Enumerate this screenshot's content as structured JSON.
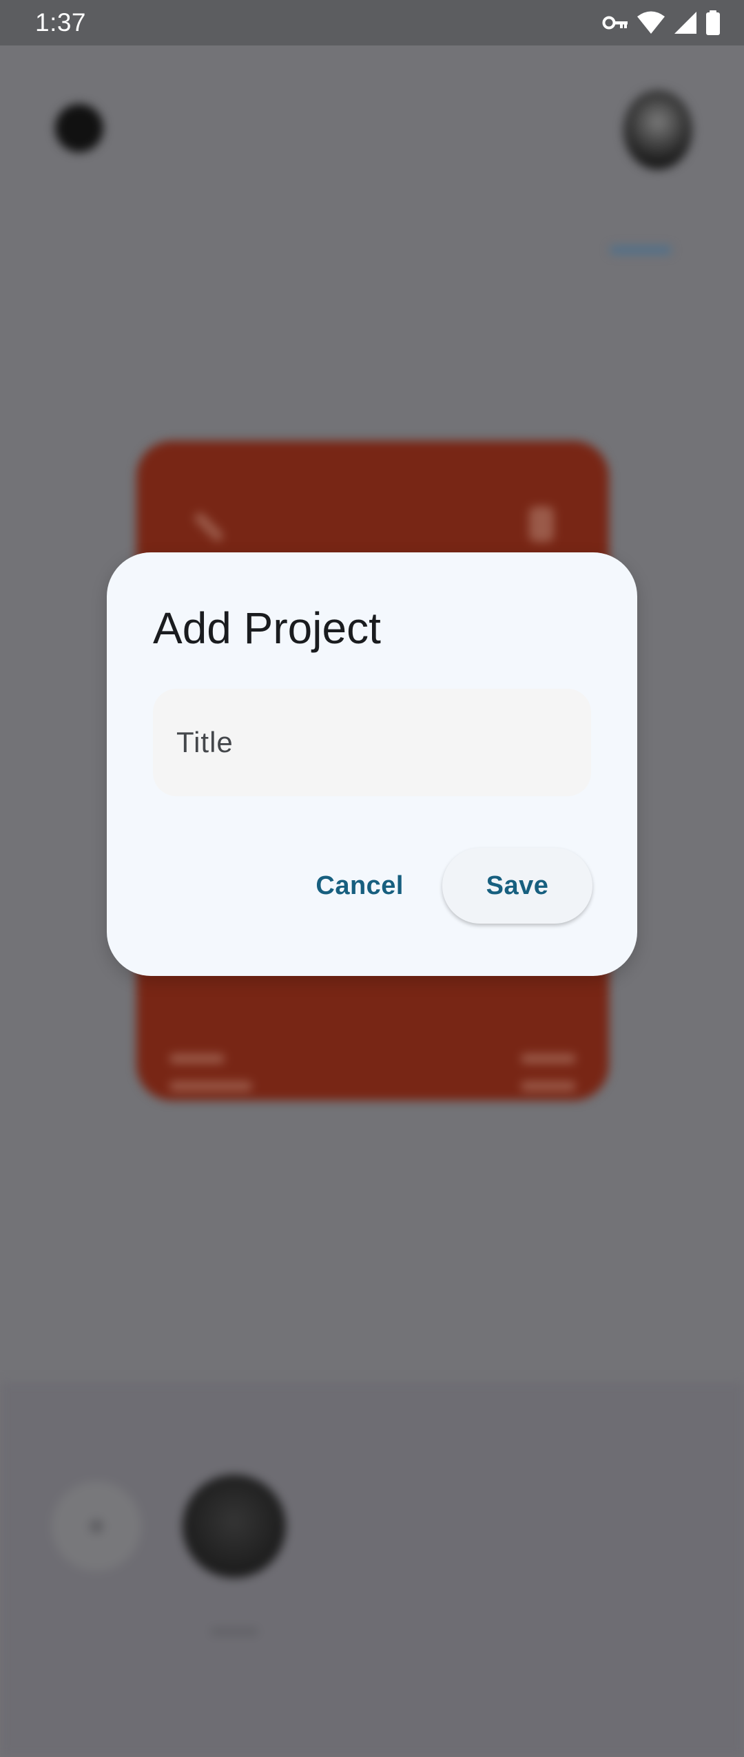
{
  "status_bar": {
    "time": "1:37",
    "icons": [
      "vpn-key-icon",
      "wifi-icon",
      "cell-signal-icon",
      "battery-icon"
    ]
  },
  "background": {
    "card_color": "#782615",
    "bottom_panel_color": "#6e6d73"
  },
  "dialog": {
    "title": "Add Project",
    "title_field": {
      "placeholder": "Title",
      "value": ""
    },
    "cancel_label": "Cancel",
    "save_label": "Save"
  },
  "colors": {
    "scrim": "#737377",
    "status_bar": "#5c5d60",
    "dialog_surface": "#f4f8fd",
    "input_fill": "#f5f5f5",
    "button_text": "#175f7f"
  }
}
